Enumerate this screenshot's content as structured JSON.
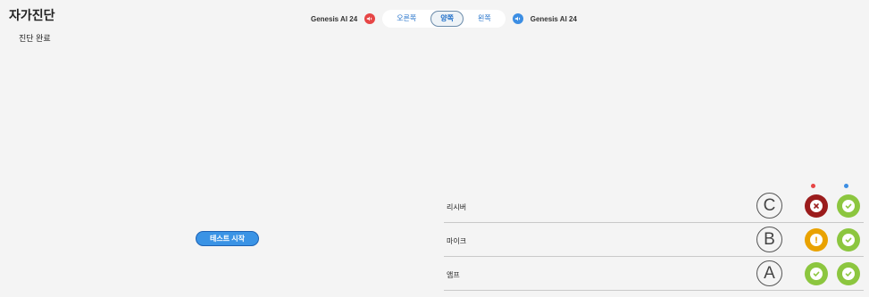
{
  "header": {
    "title": "자가진단",
    "status": "진단 완료"
  },
  "topbar": {
    "device_left": "Genesis AI 24",
    "device_right": "Genesis AI 24",
    "segments": [
      "오른쪽",
      "양쪽",
      "왼쪽"
    ],
    "active_segment": "양쪽"
  },
  "actions": {
    "start_label": "테스트 시작"
  },
  "rows": [
    {
      "label": "리시버",
      "letter": "C",
      "left_status": "error",
      "right_status": "ok"
    },
    {
      "label": "마이크",
      "letter": "B",
      "left_status": "warning",
      "right_status": "ok"
    },
    {
      "label": "앰프",
      "letter": "A",
      "left_status": "ok",
      "right_status": "ok"
    }
  ],
  "colors": {
    "left_channel": "#e64545",
    "right_channel": "#3c8ee3",
    "ok": "#8cc63f",
    "warning": "#e9a200",
    "error": "#9b1c1c"
  }
}
